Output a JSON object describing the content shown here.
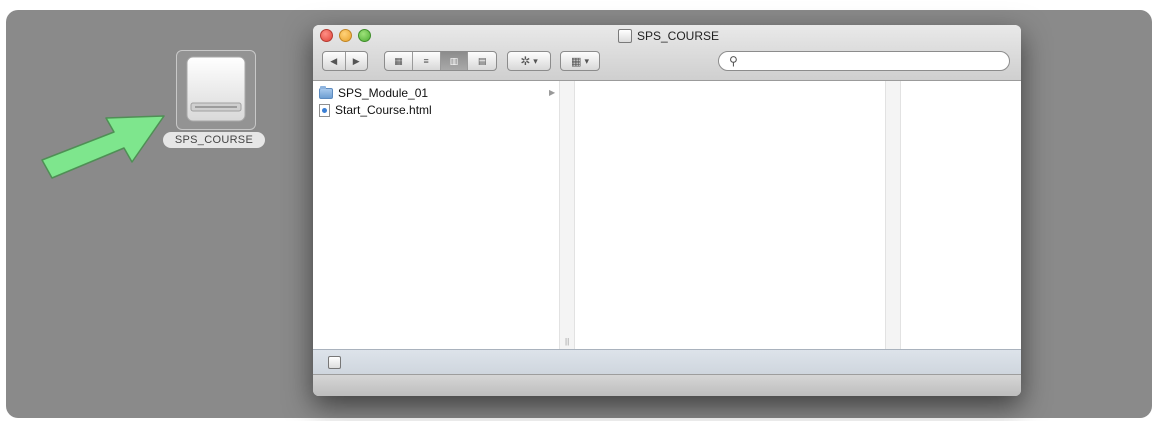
{
  "desktop": {
    "drive_label": "SPS_COURSE"
  },
  "window": {
    "title": "SPS_COURSE",
    "search": {
      "placeholder": ""
    },
    "toolbar": {
      "icons": [
        "back-icon",
        "forward-icon",
        "icon-view-icon",
        "list-view-icon",
        "column-view-icon",
        "coverflow-view-icon",
        "gear-icon",
        "arrange-icon",
        "search-icon"
      ]
    },
    "columns": [
      {
        "items": [
          {
            "label": "SPS_Module_01",
            "type": "folder"
          },
          {
            "label": "Start_Course.html",
            "type": "html"
          }
        ]
      }
    ]
  },
  "colors": {
    "desktop_bg": "#8a8a8a",
    "arrow_fill": "#7ee68d",
    "close": "#e0443a",
    "minimize": "#e9a22b",
    "zoom": "#4fae35"
  }
}
